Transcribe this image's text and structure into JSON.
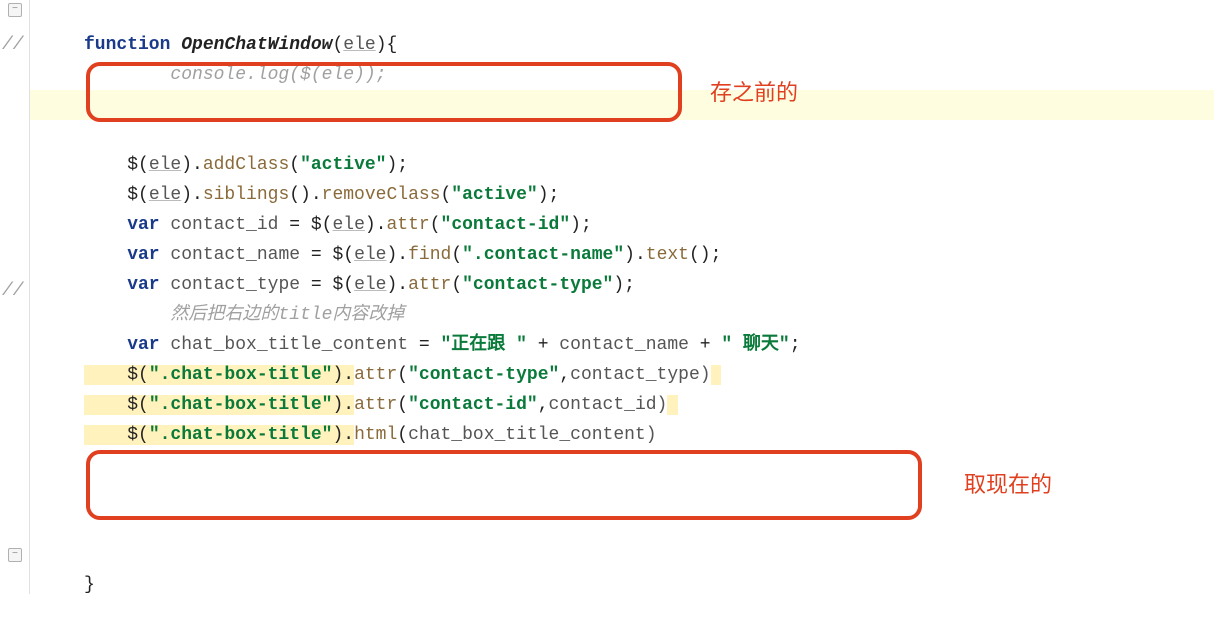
{
  "gutter": {
    "comment_marker": "//"
  },
  "code": {
    "line1": {
      "kw": "function",
      "fn": "OpenChatWindow",
      "open": "(",
      "param": "ele",
      "close": "){"
    },
    "line2": "        console.log($(ele));",
    "line4": {
      "pre": "    $(",
      "ele": "ele",
      "mid": ").",
      "method": "addClass",
      "open": "(",
      "str": "\"active\"",
      "close": ");"
    },
    "line5": {
      "pre": "    $(",
      "ele": "ele",
      "mid": ").",
      "m1": "siblings",
      "p1": "().",
      "m2": "removeClass",
      "open": "(",
      "str": "\"active\"",
      "close": ");"
    },
    "line6": {
      "kw": "    var",
      "name": " contact_id",
      "eq1": " = $(",
      "ele": "ele",
      "mid": ").",
      "method": "attr",
      "open": "(",
      "str": "\"contact-id\"",
      "close": ");"
    },
    "line7": {
      "kw": "    var",
      "name": " contact_name",
      "eq1": " = $(",
      "ele": "ele",
      "mid": ").",
      "m1": "find",
      "open1": "(",
      "str": "\".contact-name\"",
      "mid2": ").",
      "m2": "text",
      "close": "();"
    },
    "line8": {
      "kw": "    var",
      "name": " contact_type",
      "eq1": " = $(",
      "ele": "ele",
      "mid": ").",
      "method": "attr",
      "open": "(",
      "str": "\"contact-type\"",
      "close": ");"
    },
    "line9": "        然后把右边的title内容改掉",
    "line10": {
      "kw": "    var",
      "name": " chat_box_title_content",
      "eq": " = ",
      "s1": "\"正在跟 \"",
      "p1": " + ",
      "v1": "contact_name",
      "p2": " + ",
      "s2": "\" 聊天\"",
      "end": ";"
    },
    "line11": {
      "jq": "    $(",
      "sel": "\".chat-box-title\"",
      "mid": ").",
      "method": "attr",
      "open": "(",
      "arg1": "\"contact-type\"",
      "comma": ",",
      "arg2": "contact_type)"
    },
    "line12": {
      "jq": "    $(",
      "sel": "\".chat-box-title\"",
      "mid": ").",
      "method": "attr",
      "open": "(",
      "arg1": "\"contact-id\"",
      "comma": ",",
      "arg2": "contact_id)"
    },
    "line13": {
      "jq": "    $(",
      "sel": "\".chat-box-title\"",
      "mid": ").",
      "method": "html",
      "open": "(",
      "arg": "chat_box_title_content)"
    },
    "line_close": "}"
  },
  "annotations": {
    "a1": "存之前的",
    "a2": "取现在的"
  }
}
